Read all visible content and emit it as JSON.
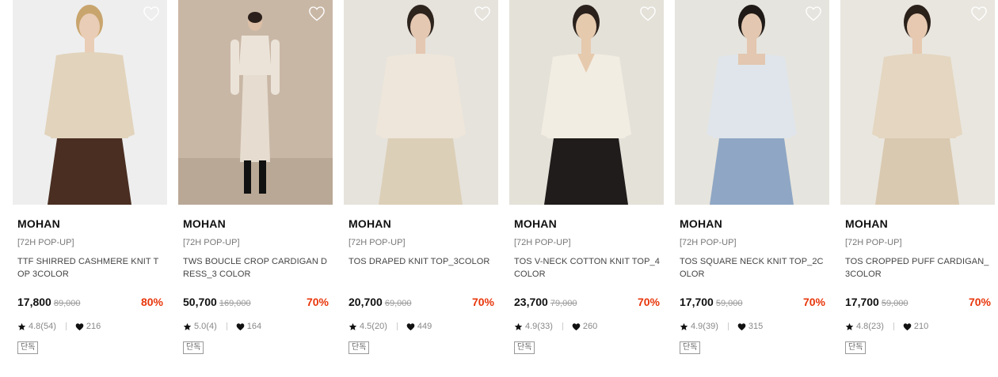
{
  "products": [
    {
      "brand": "MOHAN",
      "tag": "[72H POP-UP]",
      "name": "TTF SHIRRED CASHMERE KNIT TOP 3COLOR",
      "price": "17,800",
      "original_price": "89,000",
      "discount": "80%",
      "rating": "4.8(54)",
      "likes": "216",
      "badge": "단독",
      "image": {
        "bg": "#eeeeee",
        "top": "#e2d3bc",
        "bottom": "#4a2e22",
        "hair": "#c9a56e",
        "skin": "#e9cdb6"
      }
    },
    {
      "brand": "MOHAN",
      "tag": "[72H POP-UP]",
      "name": "TWS BOUCLE CROP CARDIGAN DRESS_3 COLOR",
      "price": "50,700",
      "original_price": "169,000",
      "discount": "70%",
      "rating": "5.0(4)",
      "likes": "164",
      "badge": "단독",
      "image": {
        "bg": "#c9b7a6",
        "top": "#ebe3d8",
        "bottom": "#e6ddd0",
        "hair": "#2a1f1a",
        "skin": "#dcbfa6"
      }
    },
    {
      "brand": "MOHAN",
      "tag": "[72H POP-UP]",
      "name": "TOS DRAPED KNIT TOP_3COLOR",
      "price": "20,700",
      "original_price": "69,000",
      "discount": "70%",
      "rating": "4.5(20)",
      "likes": "449",
      "badge": "단독",
      "image": {
        "bg": "#e6e3dc",
        "top": "#eee6da",
        "bottom": "#dccfb8",
        "hair": "#2e241e",
        "skin": "#e5c8b2"
      }
    },
    {
      "brand": "MOHAN",
      "tag": "[72H POP-UP]",
      "name": "TOS V-NECK COTTON KNIT TOP_4COLOR",
      "price": "23,700",
      "original_price": "79,000",
      "discount": "70%",
      "rating": "4.9(33)",
      "likes": "260",
      "badge": "단독",
      "image": {
        "bg": "#e4e1d9",
        "top": "#f2ede2",
        "bottom": "#1f1c1b",
        "hair": "#2a211c",
        "skin": "#e6caae"
      }
    },
    {
      "brand": "MOHAN",
      "tag": "[72H POP-UP]",
      "name": "TOS SQUARE NECK KNIT TOP_2COLOR",
      "price": "17,700",
      "original_price": "59,000",
      "discount": "70%",
      "rating": "4.9(39)",
      "likes": "315",
      "badge": "단독",
      "image": {
        "bg": "#e6e4de",
        "top": "#dfe5ea",
        "bottom": "#8fa7c4",
        "hair": "#1f1a17",
        "skin": "#e3c7b0"
      }
    },
    {
      "brand": "MOHAN",
      "tag": "[72H POP-UP]",
      "name": "TOS CROPPED PUFF CARDIGAN_3COLOR",
      "price": "17,700",
      "original_price": "59,000",
      "discount": "70%",
      "rating": "4.8(23)",
      "likes": "210",
      "badge": "단독",
      "image": {
        "bg": "#e9e6df",
        "top": "#e4d6c0",
        "bottom": "#d9c9b0",
        "hair": "#2b211b",
        "skin": "#e6c9b0"
      }
    }
  ],
  "colors": {
    "discount": "#e8360b",
    "price": "#111111",
    "muted": "#888888"
  },
  "icons": {
    "wishlist": "heart-outline-icon",
    "rating": "star-icon",
    "likes": "heart-filled-icon"
  }
}
